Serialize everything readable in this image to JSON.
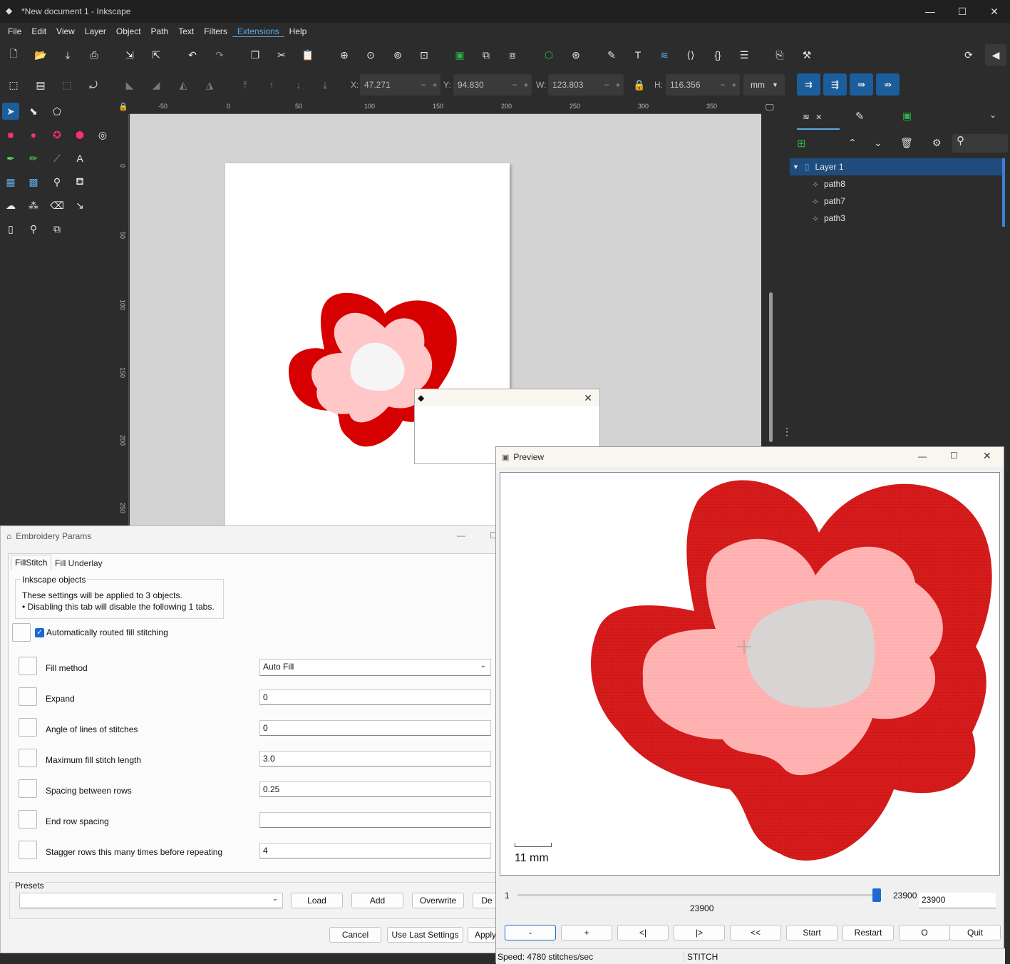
{
  "app": {
    "title": "*New document 1 - Inkscape",
    "menu": [
      "File",
      "Edit",
      "View",
      "Layer",
      "Object",
      "Path",
      "Text",
      "Filters",
      "Extensions",
      "Help"
    ],
    "active_menu": "Extensions"
  },
  "toolbar": {
    "x_label": "X:",
    "x_value": "47.271",
    "y_label": "Y:",
    "y_value": "94.830",
    "w_label": "W:",
    "w_value": "123.803",
    "h_label": "H:",
    "h_value": "116.356",
    "unit": "mm"
  },
  "ruler": {
    "h_ticks": [
      "-50",
      "0",
      "50",
      "100",
      "150",
      "200",
      "250",
      "300",
      "350"
    ],
    "v_ticks": [
      "0",
      "50",
      "100",
      "150",
      "200",
      "250"
    ]
  },
  "layers": {
    "items": [
      {
        "name": "Layer 1",
        "type": "layer"
      },
      {
        "name": "path8",
        "type": "path"
      },
      {
        "name": "path7",
        "type": "path"
      },
      {
        "name": "path3",
        "type": "path"
      }
    ]
  },
  "embroidery": {
    "title": "Embroidery Params",
    "tabs": [
      "FillStitch",
      "Fill Underlay"
    ],
    "group_title": "Inkscape objects",
    "info_line1": "These settings will be applied to 3 objects.",
    "info_line2": "• Disabling this tab will disable the following 1 tabs.",
    "auto_route_label": "Automatically routed fill stitching",
    "params": [
      {
        "label": "Fill method",
        "value": "Auto Fill"
      },
      {
        "label": "Expand",
        "value": "0"
      },
      {
        "label": "Angle of lines of stitches",
        "value": "0"
      },
      {
        "label": "Maximum fill stitch length",
        "value": "3.0"
      },
      {
        "label": "Spacing between rows",
        "value": "0.25"
      },
      {
        "label": "End row spacing",
        "value": ""
      },
      {
        "label": "Stagger rows this many times before repeating",
        "value": "4"
      }
    ],
    "presets_label": "Presets",
    "preset_buttons": [
      "Load",
      "Add",
      "Overwrite",
      "De"
    ],
    "bottom_buttons": [
      "Cancel",
      "Use Last Settings",
      "Apply"
    ]
  },
  "preview": {
    "title": "Preview",
    "scale": "11 mm",
    "slider_min": "1",
    "slider_max": "23900",
    "slider_current": "23900",
    "slider_input": "23900",
    "slider_fraction": 1.0,
    "controls": [
      "-",
      "+",
      "<|",
      "|>",
      "<<",
      "Start",
      "Restart",
      "O",
      "Quit"
    ],
    "status_speed": "Speed: 4780 stitches/sec",
    "status_mode": "STITCH"
  },
  "colors": {
    "outer": "#d70000",
    "middle": "#ffc7c7",
    "center": "#f5f5f5",
    "preview_outer": "#d81c1c",
    "preview_middle": "#ffb3b3",
    "preview_center": "#d8d4d4",
    "accent": "#1c5d9c"
  }
}
